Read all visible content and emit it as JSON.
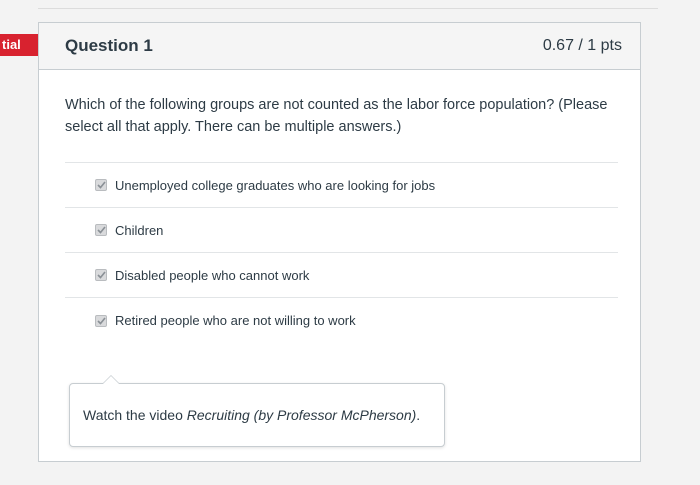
{
  "side_tag": {
    "label": "tial"
  },
  "question": {
    "title": "Question 1",
    "points": "0.67 / 1 pts",
    "text": "Which of the following groups are not counted as the labor force population? (Please select all that apply. There can be multiple answers.)",
    "answers": [
      {
        "label": "Unemployed college graduates who are looking for jobs",
        "checked": true
      },
      {
        "label": "Children",
        "checked": true
      },
      {
        "label": "Disabled people who cannot work",
        "checked": true
      },
      {
        "label": "Retired people who are not willing to work",
        "checked": true
      }
    ]
  },
  "feedback": {
    "prefix": "Watch the video ",
    "video_title": "Recruiting (by Professor McPherson)",
    "suffix": "."
  },
  "colors": {
    "side_tag": "#d8222f",
    "text": "#2d3b45",
    "border": "#c7cdd1"
  }
}
